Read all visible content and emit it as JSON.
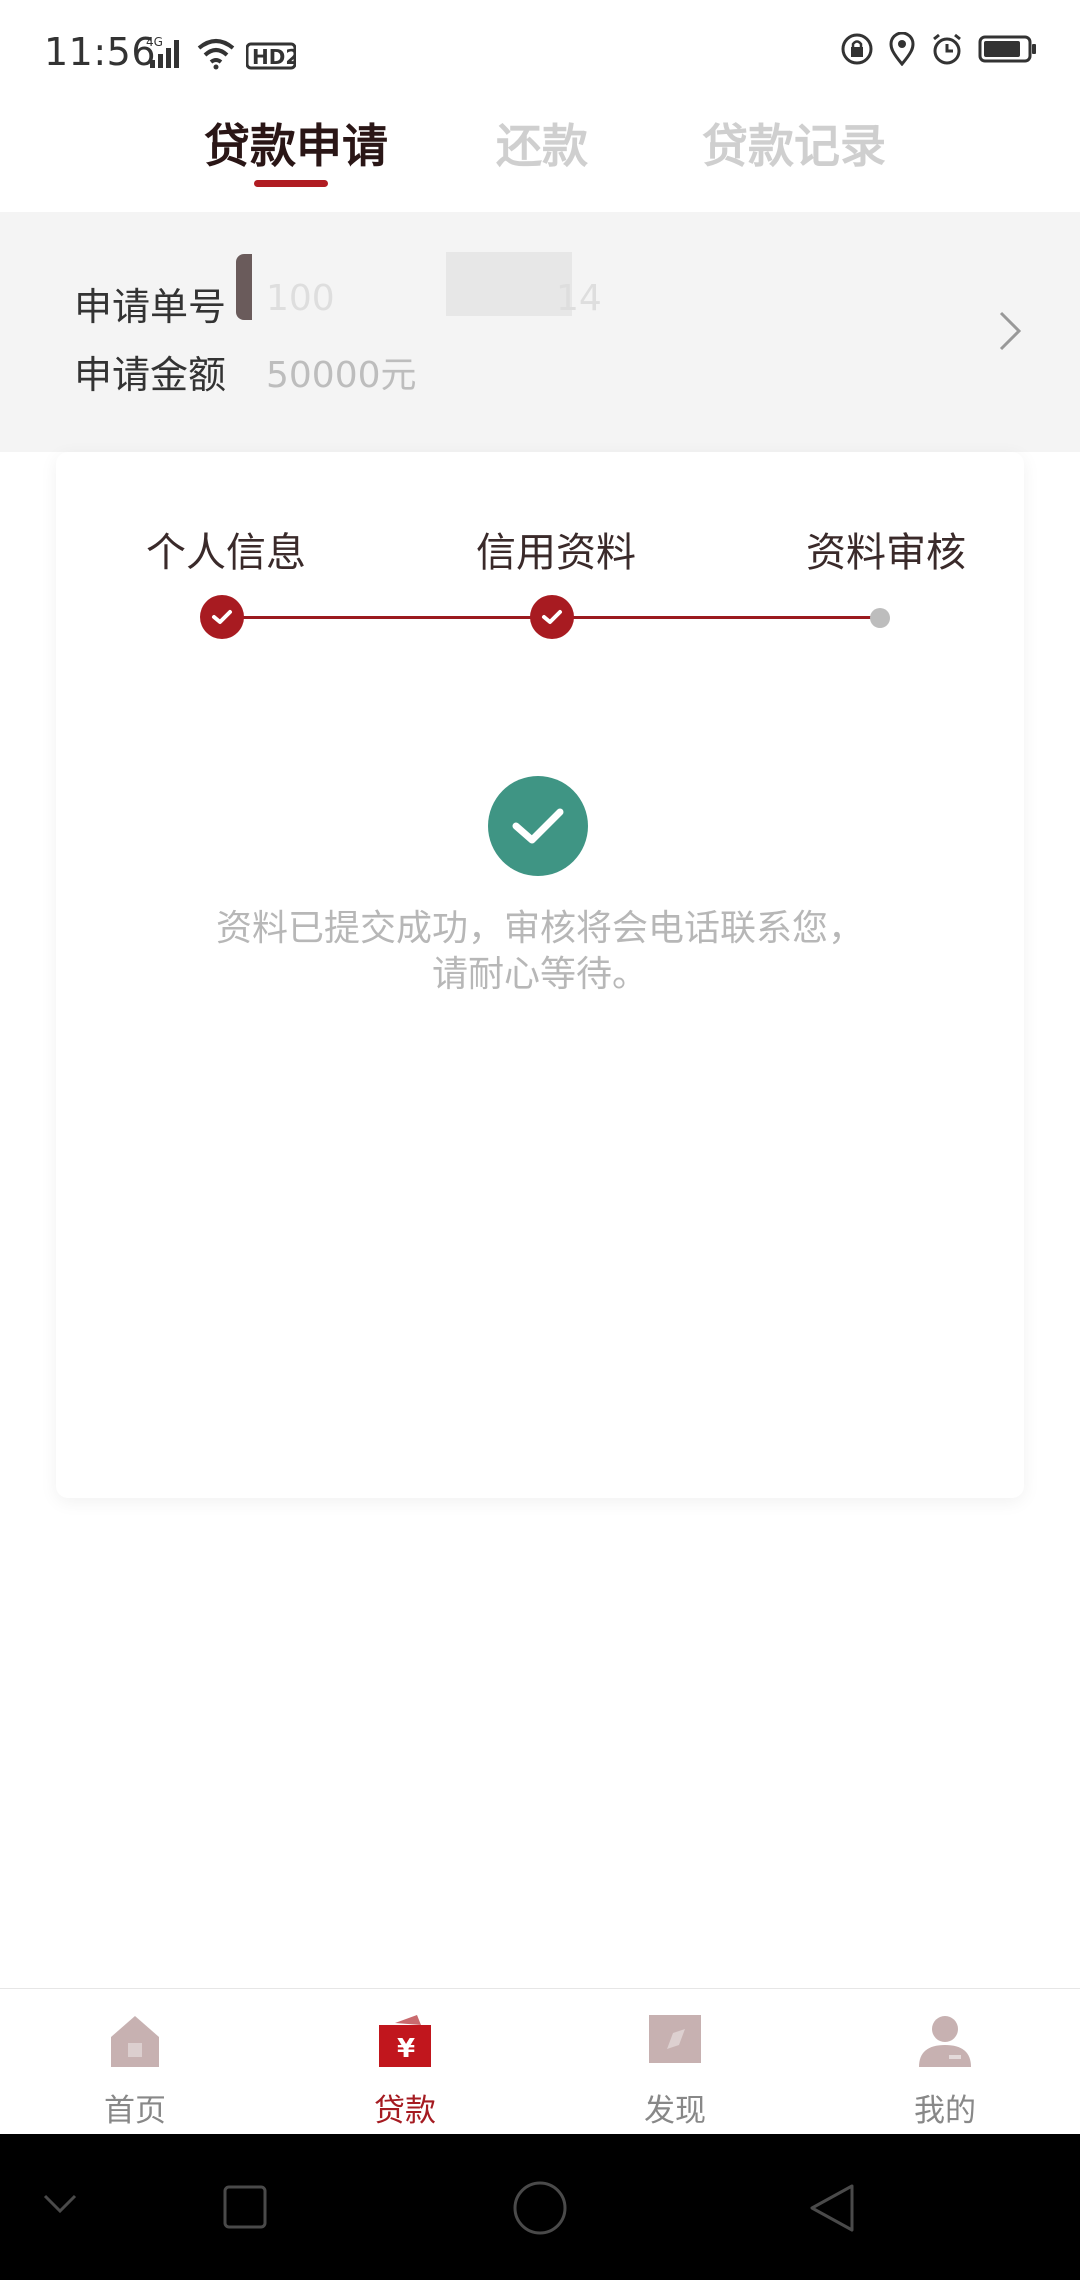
{
  "status_bar": {
    "time": "11:56",
    "network": "4G",
    "hd_label": "HD2"
  },
  "tabs": [
    {
      "label": "贷款申请",
      "active": true
    },
    {
      "label": "还款",
      "active": false
    },
    {
      "label": "贷款记录",
      "active": false
    }
  ],
  "application": {
    "number_label": "申请单号",
    "number_value_partial": "100",
    "number_value_end": "14",
    "amount_label": "申请金额",
    "amount_value": "50000元"
  },
  "steps": [
    {
      "label": "个人信息",
      "status": "done"
    },
    {
      "label": "信用资料",
      "status": "done"
    },
    {
      "label": "资料审核",
      "status": "pending"
    }
  ],
  "result": {
    "message": "资料已提交成功，审核将会电话联系您，请耐心等待。",
    "color": "#3f9584"
  },
  "bottom_nav": [
    {
      "label": "首页",
      "icon": "home-icon",
      "active": false
    },
    {
      "label": "贷款",
      "icon": "loan-icon",
      "active": true
    },
    {
      "label": "发现",
      "icon": "discover-icon",
      "active": false
    },
    {
      "label": "我的",
      "icon": "profile-icon",
      "active": false
    }
  ],
  "colors": {
    "accent": "#a81b21",
    "success": "#3f9584",
    "muted_text": "#b7b7b7"
  }
}
